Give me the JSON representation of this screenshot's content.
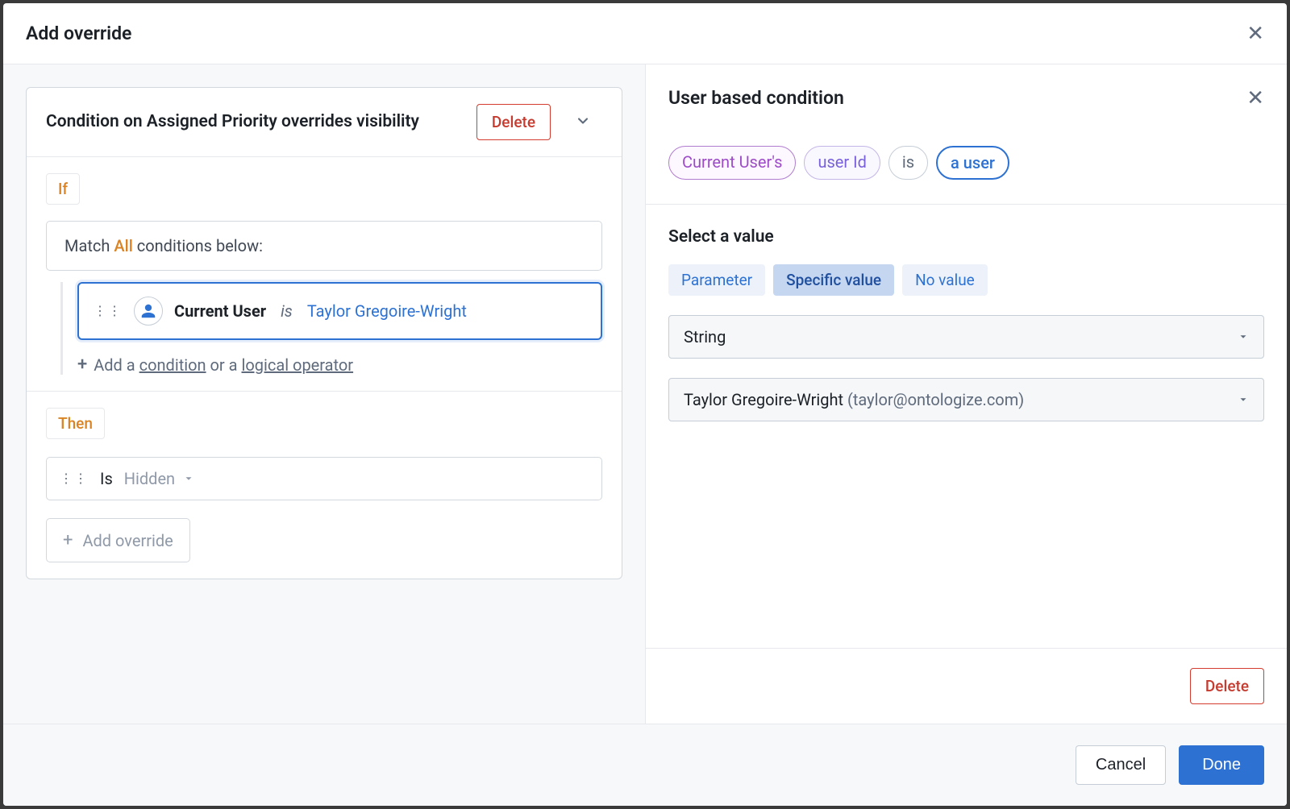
{
  "modal": {
    "title": "Add override"
  },
  "left": {
    "card_title": "Condition on Assigned Priority overrides visibility",
    "delete_label": "Delete",
    "if_label": "If",
    "match_prefix": "Match ",
    "match_all": "All",
    "match_suffix": " conditions below:",
    "condition": {
      "subject": "Current User",
      "operator": "is",
      "value": "Taylor Gregoire-Wright"
    },
    "add_cond_plus": "+",
    "add_cond_text1": "Add a ",
    "add_cond_link1": "condition",
    "add_cond_text2": " or a ",
    "add_cond_link2": "logical operator",
    "then_label": "Then",
    "is_label": "Is",
    "is_value": "Hidden",
    "add_override_label": "Add override"
  },
  "right": {
    "title": "User based condition",
    "tokens": {
      "t1": "Current User's",
      "t2": "user Id",
      "t3": "is",
      "t4": "a user"
    },
    "select_label": "Select a value",
    "tabs": {
      "param": "Parameter",
      "specific": "Specific value",
      "novalue": "No value"
    },
    "type_select": "String",
    "value_name": "Taylor Gregoire-Wright",
    "value_email": "(taylor@ontologize.com)",
    "delete_label": "Delete"
  },
  "footer": {
    "cancel": "Cancel",
    "done": "Done"
  }
}
